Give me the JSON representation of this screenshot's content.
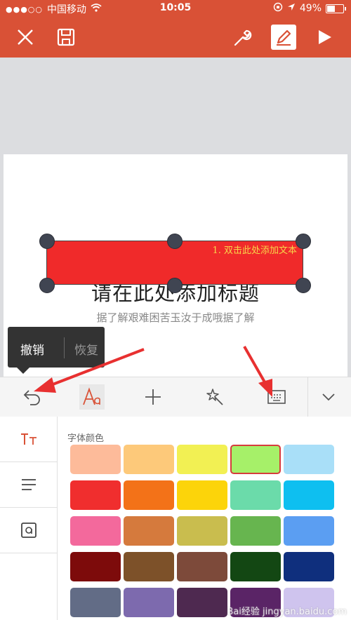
{
  "status_bar": {
    "carrier": "中国移动",
    "time": "10:05",
    "battery": "49%",
    "battery_level": 0.49
  },
  "slide": {
    "textbox_text": "1. 双击此处添加文本",
    "title": "请在此处添加标题",
    "subtitle": "据了解艰难困苦玉汝于成哦据了解"
  },
  "tooltip": {
    "undo_label": "撤销",
    "redo_label": "恢复"
  },
  "panel": {
    "section_label": "字体颜色",
    "swatch_colors": [
      [
        "#fdbb9a",
        "#fdc97a",
        "#f2f053",
        "#a6f069",
        "#a9dff8"
      ],
      [
        "#f02e2e",
        "#f37218",
        "#fcd40a",
        "#6bdbaa",
        "#0ebff0"
      ],
      [
        "#f3699c",
        "#d57a3d",
        "#c9bd4e",
        "#67b54f",
        "#5b9ef2"
      ],
      [
        "#7d0b0b",
        "#7d5129",
        "#7d4a3a",
        "#134713",
        "#0f2f7d"
      ],
      [
        "#626c86",
        "#7d6aae",
        "#4e2950",
        "#5a2466",
        "#cfc4ee"
      ]
    ],
    "selected": {
      "row": 0,
      "col": 3
    }
  },
  "colors": {
    "accent": "#d95136",
    "text_box_fill": "#f02a2a",
    "text_box_text": "#f7d64a"
  },
  "watermark": "Bai经验 jingyan.baidu.com"
}
